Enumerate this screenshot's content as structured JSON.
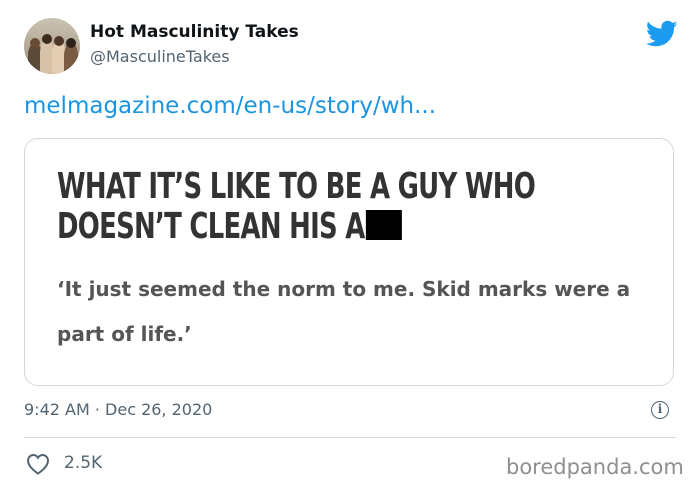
{
  "author": {
    "name": "Hot Masculinity Takes",
    "handle": "@MasculineTakes"
  },
  "tweet": {
    "link_text": "melmagazine.com/en-us/story/wh...",
    "timestamp": "9:42 AM · Dec 26, 2020",
    "likes": "2.5K"
  },
  "card": {
    "headline_line1": "WHAT IT’S LIKE TO BE A GUY WHO",
    "headline_line2": "DOESN’T CLEAN HIS A",
    "subheadline": "‘It just seemed the norm to me. Skid marks were a part of life.’"
  },
  "icons": {
    "bird": "twitter-bird-icon",
    "info": "info-icon",
    "heart": "heart-icon"
  },
  "colors": {
    "brand": "#1d9bf0",
    "link": "#1b95e0",
    "secondary_text": "#536471"
  },
  "watermark": "boredpanda.com"
}
